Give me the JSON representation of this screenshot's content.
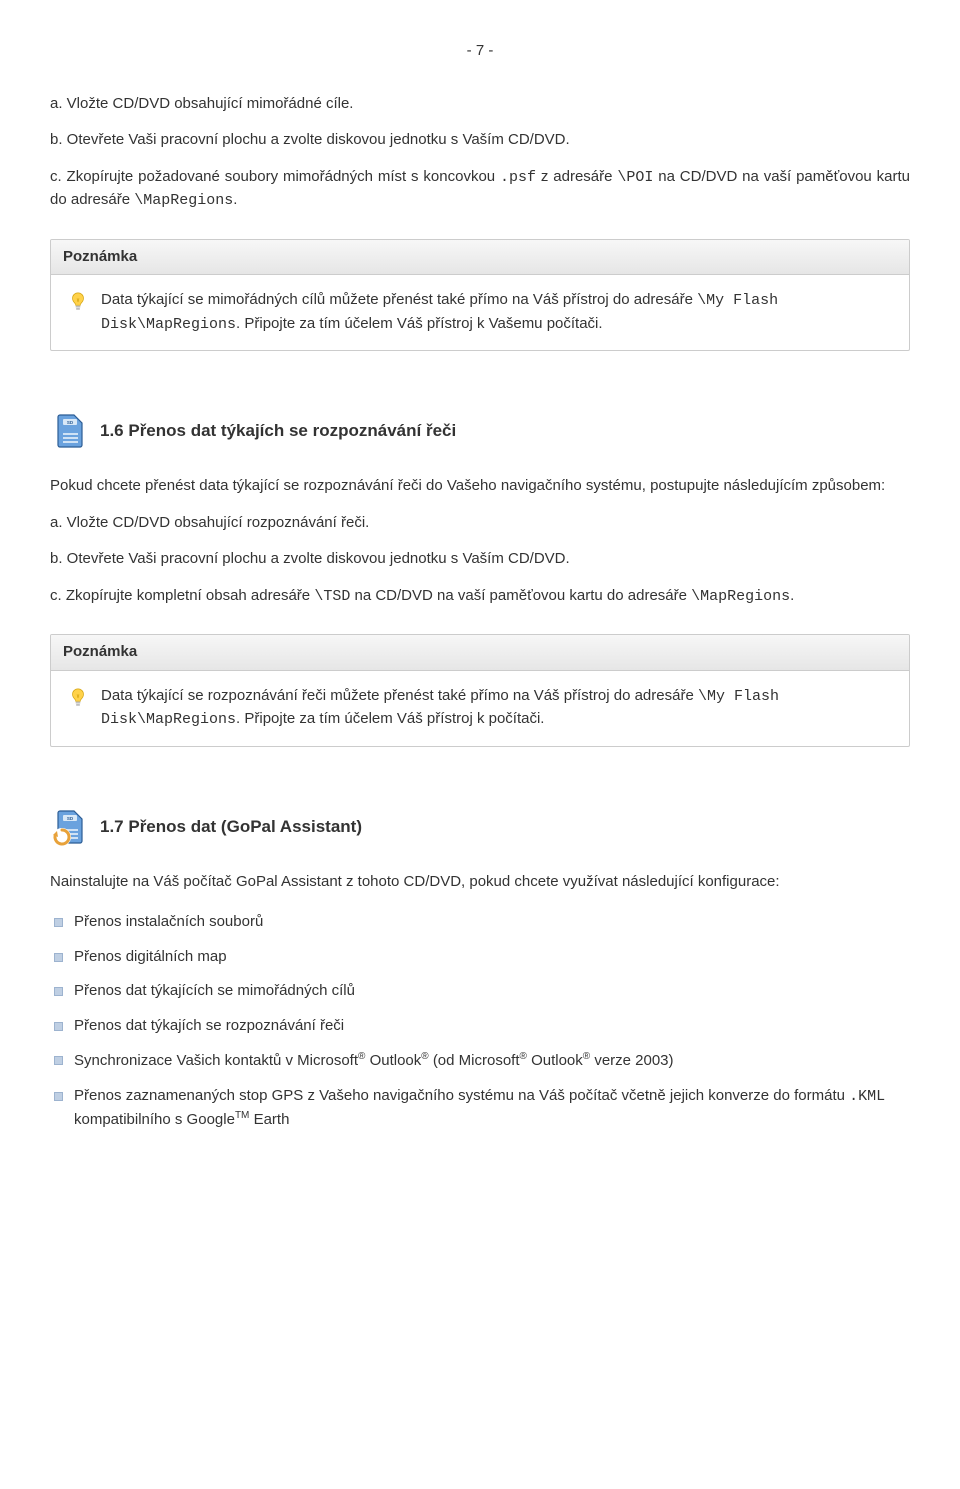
{
  "page_number": "- 7 -",
  "intro_steps": {
    "a": "a. Vložte CD/DVD obsahující mimořádné cíle.",
    "b": "b. Otevřete Vaši pracovní plochu a zvolte diskovou jednotku s Vaším CD/DVD.",
    "c_pre": "c. Zkopírujte požadované soubory mimořádných míst s koncovkou",
    "c_code1": ".psf",
    "c_mid1": " z adresáře ",
    "c_code2": "\\POI",
    "c_mid2": " na CD/DVD na vaší paměťovou kartu do adresáře ",
    "c_code3": "\\MapRegions",
    "c_end": "."
  },
  "note_label": "Poznámka",
  "note1": {
    "t1": "Data týkající se mimořádných cílů můžete přenést také přímo na Váš přístroj do adresáře ",
    "code": "\\My Flash Disk\\MapRegions",
    "t2": ". Připojte za tím účelem Váš přístroj k Vašemu počítači."
  },
  "section16": {
    "title": "1.6 Přenos dat týkajích se rozpoznávání řeči",
    "intro": "Pokud chcete přenést data týkající se rozpoznávání řeči do Vašeho navigačního systému, postupujte následujícím způsobem:",
    "a": "a. Vložte CD/DVD obsahující rozpoznávání řeči.",
    "b": "b. Otevřete Vaši pracovní plochu a zvolte diskovou jednotku s Vaším CD/DVD.",
    "c_pre": "c. Zkopírujte kompletní obsah adresáře ",
    "c_code1": "\\TSD",
    "c_mid": " na CD/DVD na vaší paměťovou kartu do adresáře ",
    "c_code2": "\\MapRegions",
    "c_end": "."
  },
  "note2": {
    "t1": "Data týkající se rozpoznávání řeči můžete přenést také přímo na Váš přístroj do adresáře ",
    "code": "\\My Flash Disk\\MapRegions",
    "t2": ". Připojte za tím účelem Váš přístroj k počítači."
  },
  "section17": {
    "title": "1.7 Přenos dat (GoPal Assistant)",
    "intro": "Nainstalujte na Váš počítač GoPal Assistant z tohoto CD/DVD, pokud chcete využívat následující konfigurace:",
    "items": [
      "Přenos instalačních souborů",
      "Přenos digitálních map",
      "Přenos dat týkajících se mimořádných cílů",
      "Přenos dat týkajích se rozpoznávání řeči"
    ],
    "sync_pre": "Synchronizace Vašich kontaktů v Microsoft",
    "sync_out": " Outlook",
    "sync_mid": " (od Microsoft",
    "sync_post": " verze 2003)",
    "gps_pre": "Přenos zaznamenaných stop GPS z Vašeho navigačního systému na Váš počítač včetně jejich konverze do formátu ",
    "gps_code": ".KML",
    "gps_mid": " kompatibilního s Google",
    "gps_tm": "TM",
    "gps_post": " Earth"
  }
}
